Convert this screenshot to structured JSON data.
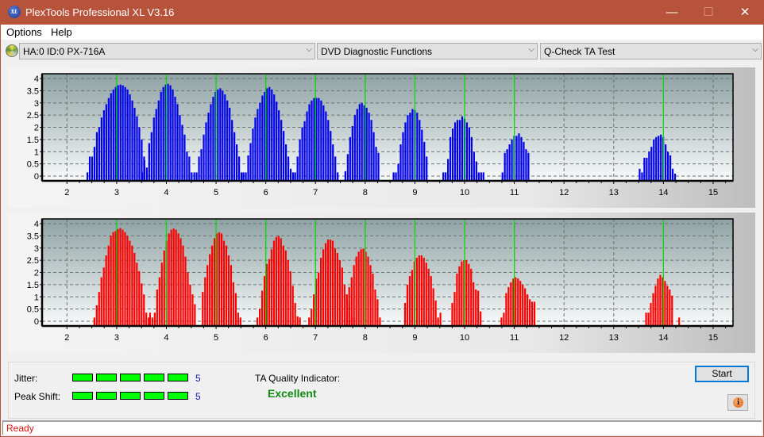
{
  "window": {
    "title": "PlexTools Professional XL V3.16",
    "logo_text": "XL",
    "controls": {
      "minimize": "—",
      "maximize": "☐",
      "close": "✕"
    }
  },
  "menu": [
    "Options",
    "Help"
  ],
  "toolbar": {
    "drive_icon": "disc-icon",
    "drive": "HA:0 ID:0  PX-716A",
    "function": "DVD Diagnostic Functions",
    "test": "Q-Check TA Test",
    "dropdown_arrow": "⌵"
  },
  "chart_data": [
    {
      "type": "bar",
      "name": "upper-ta-histogram",
      "color": "#0000ee",
      "peak_line_color": "#00dd00",
      "xlim": [
        1.5,
        15.4
      ],
      "ylim": [
        0,
        4.15
      ],
      "xticks": [
        2,
        3,
        4,
        5,
        6,
        7,
        8,
        9,
        10,
        11,
        12,
        13,
        14,
        15
      ],
      "yticks": [
        0,
        0.5,
        1,
        1.5,
        2,
        2.5,
        3,
        3.5,
        4
      ],
      "ytick_labels": [
        "0",
        "0.5",
        "1",
        "1.5",
        "2",
        "2.5",
        "3",
        "3.5",
        "4"
      ],
      "peak_lines": [
        3,
        4,
        5,
        6,
        7,
        8,
        9,
        10,
        11,
        14
      ],
      "grid": true,
      "bar_step": 0.0475,
      "peaks": [
        {
          "start": 2.41,
          "values": [
            0.15,
            0.8,
            0.8,
            1.2,
            1.8,
            2.0,
            2.4,
            2.7,
            2.95,
            3.2,
            3.4,
            3.55,
            3.65,
            3.72,
            3.75,
            3.72,
            3.65,
            3.55,
            3.35,
            3.1,
            2.8,
            2.45,
            2.0,
            1.5,
            0.8
          ]
        },
        {
          "start": 3.51,
          "values": [
            0.15,
            0.65,
            0.35,
            1.35,
            1.8,
            2.4,
            2.75,
            3.1,
            3.45,
            3.65,
            3.75,
            3.78,
            3.72,
            3.55,
            3.25,
            2.95,
            2.5,
            2.1,
            1.7,
            1.0,
            0.8,
            0.15
          ]
        },
        {
          "start": 4.56,
          "values": [
            0.15,
            0.15,
            0.8,
            1.1,
            1.7,
            2.2,
            2.6,
            2.95,
            3.25,
            3.45,
            3.55,
            3.6,
            3.5,
            3.35,
            3.1,
            2.8,
            2.3,
            1.8,
            1.3,
            0.8,
            0.15
          ]
        },
        {
          "start": 5.55,
          "values": [
            0.15,
            0.15,
            0.85,
            1.35,
            1.95,
            2.4,
            2.75,
            3.0,
            3.3,
            3.45,
            3.6,
            3.65,
            3.55,
            3.35,
            3.05,
            2.7,
            2.3,
            1.85,
            1.3,
            0.8,
            0.3,
            0.15
          ]
        },
        {
          "start": 6.59,
          "values": [
            0.15,
            0.8,
            1.5,
            2.0,
            2.25,
            2.65,
            2.95,
            3.1,
            3.2,
            3.2,
            3.2,
            3.1,
            2.9,
            2.65,
            2.3,
            1.85,
            1.3,
            0.8,
            0.15
          ]
        },
        {
          "start": 7.6,
          "values": [
            0.2,
            0.9,
            1.6,
            2.05,
            2.5,
            2.75,
            2.95,
            3.0,
            2.9,
            2.8,
            2.6,
            2.3,
            1.8,
            1.2,
            0.95
          ]
        },
        {
          "start": 8.57,
          "values": [
            0.15,
            0.15,
            0.5,
            1.3,
            1.8,
            2.2,
            2.5,
            2.6,
            2.75,
            2.7,
            2.6,
            2.3,
            1.9,
            1.4,
            0.8
          ]
        },
        {
          "start": 9.57,
          "values": [
            0.15,
            0.15,
            0.7,
            1.6,
            1.95,
            2.2,
            2.3,
            2.3,
            2.45,
            2.35,
            2.2,
            2.0,
            1.6,
            1.0,
            0.6,
            0.15,
            0.15,
            0.15
          ]
        },
        {
          "start": 10.76,
          "values": [
            0.15,
            0.95,
            1.1,
            1.3,
            1.5,
            1.65,
            1.65,
            1.75,
            1.6,
            1.4,
            1.1,
            0.95
          ]
        },
        {
          "start": 13.52,
          "values": [
            0.3,
            0.15,
            0.75,
            0.75,
            1.0,
            1.2,
            1.5,
            1.6,
            1.65,
            1.7,
            1.6,
            1.3,
            1.0,
            0.85,
            0.3,
            0.1
          ]
        }
      ]
    },
    {
      "type": "bar",
      "name": "lower-ta-histogram",
      "color": "#ff0000",
      "peak_line_color": "#00dd00",
      "xlim": [
        1.5,
        15.4
      ],
      "ylim": [
        0,
        4.15
      ],
      "xticks": [
        2,
        3,
        4,
        5,
        6,
        7,
        8,
        9,
        10,
        11,
        12,
        13,
        14,
        15
      ],
      "yticks": [
        0,
        0.5,
        1,
        1.5,
        2,
        2.5,
        3,
        3.5,
        4
      ],
      "ytick_labels": [
        "0",
        "0.5",
        "1",
        "1.5",
        "2",
        "2.5",
        "3",
        "3.5",
        "4"
      ],
      "peak_lines": [
        3,
        4,
        5,
        6,
        7,
        8,
        9,
        10,
        11,
        14
      ],
      "grid": true,
      "bar_step": 0.0475,
      "peaks": [
        {
          "start": 2.55,
          "values": [
            0.15,
            0.65,
            1.2,
            1.8,
            2.2,
            2.7,
            3.1,
            3.5,
            3.65,
            3.7,
            3.78,
            3.82,
            3.75,
            3.65,
            3.5,
            3.3,
            3.1,
            2.8,
            2.4,
            2.05,
            1.55,
            1.1,
            0.35,
            0.15
          ]
        },
        {
          "start": 3.67,
          "values": [
            0.35,
            0.15,
            0.35,
            1.3,
            1.8,
            2.4,
            2.9,
            3.3,
            3.6,
            3.75,
            3.8,
            3.75,
            3.6,
            3.4,
            3.1,
            2.65,
            2.0,
            1.5,
            1.1,
            0.7
          ]
        },
        {
          "start": 4.73,
          "values": [
            1.2,
            1.8,
            2.3,
            2.75,
            3.1,
            3.4,
            3.6,
            3.65,
            3.6,
            3.3,
            3.1,
            2.7,
            2.3,
            1.6,
            1.15,
            0.35,
            0.15
          ]
        },
        {
          "start": 5.83,
          "values": [
            0.15,
            0.5,
            1.25,
            1.85,
            2.35,
            2.55,
            2.95,
            3.3,
            3.45,
            3.5,
            3.4,
            3.1,
            2.9,
            2.5,
            2.05,
            1.45,
            0.75,
            0.2,
            0.15
          ]
        },
        {
          "start": 6.87,
          "values": [
            0.15,
            0.5,
            1.1,
            1.75,
            2.0,
            2.6,
            2.95,
            3.2,
            3.35,
            3.35,
            3.3,
            3.0,
            2.8,
            2.5,
            2.2,
            1.5,
            1.1,
            0.75,
            0.2,
            0.15
          ]
        },
        {
          "start": 7.63,
          "values": [
            1.1,
            1.4,
            1.8,
            2.3,
            2.65,
            2.85,
            2.95,
            2.98,
            2.85,
            2.65,
            2.3,
            1.95,
            1.3,
            0.9,
            0.15
          ]
        },
        {
          "start": 8.8,
          "values": [
            0.75,
            1.5,
            1.85,
            2.1,
            2.45,
            2.6,
            2.7,
            2.7,
            2.6,
            2.4,
            2.15,
            1.85,
            1.35,
            0.85,
            0.15,
            0.35
          ]
        },
        {
          "start": 9.75,
          "values": [
            0.75,
            1.2,
            1.95,
            2.25,
            2.45,
            2.5,
            2.5,
            2.35,
            2.15,
            1.6,
            1.3,
            1.25,
            0.4
          ]
        },
        {
          "start": 10.74,
          "values": [
            0.15,
            0.35,
            1.15,
            1.4,
            1.6,
            1.75,
            1.8,
            1.75,
            1.65,
            1.5,
            1.35,
            1.1,
            0.9,
            0.8,
            0.8
          ]
        },
        {
          "start": 13.65,
          "values": [
            0.35,
            0.35,
            0.75,
            1.15,
            1.45,
            1.75,
            1.9,
            1.8,
            1.65,
            1.45,
            1.3,
            1.05,
            0,
            0,
            0.15
          ]
        }
      ]
    }
  ],
  "results": {
    "jitter_label": "Jitter:",
    "jitter_segments": 5,
    "jitter_value": "5",
    "peak_shift_label": "Peak Shift:",
    "peak_shift_segments": 5,
    "peak_shift_value": "5",
    "ta_quality_label": "TA Quality Indicator:",
    "ta_quality_value": "Excellent"
  },
  "buttons": {
    "start": "Start",
    "info": "i"
  },
  "status": "Ready"
}
